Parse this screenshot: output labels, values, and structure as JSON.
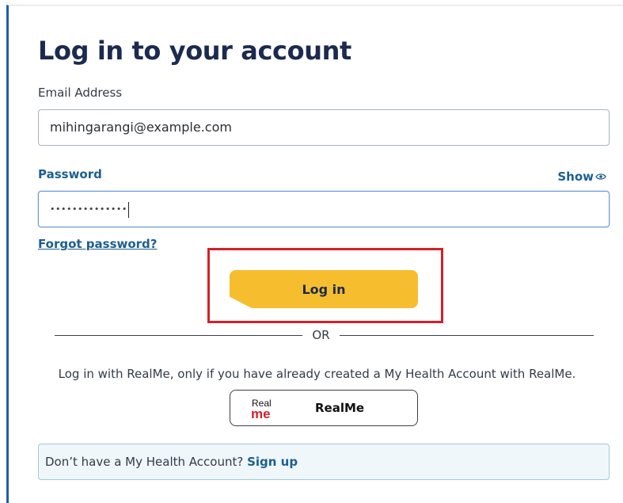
{
  "form": {
    "title": "Log in to your account",
    "email_label": "Email Address",
    "email_value": "mihingarangi@example.com",
    "password_label": "Password",
    "password_masked": "••••••••••••••",
    "show_label": "Show",
    "forgot_label": "Forgot password?",
    "login_label": "Log in"
  },
  "alt_login": {
    "divider_text": "OR",
    "note": "Log in with RealMe, only if you have already created a My Health Account with RealMe.",
    "realme_logo_top": "Real",
    "realme_logo_bottom": "me",
    "realme_label": "RealMe"
  },
  "signup": {
    "prompt": "Don’t have a My Health Account? ",
    "link_label": "Sign up"
  },
  "colors": {
    "accent_blue": "#1c5f91",
    "heading_navy": "#1b2a4e",
    "login_yellow": "#f6bd2e",
    "highlight_red": "#d4202a",
    "realme_red": "#d4202a"
  }
}
